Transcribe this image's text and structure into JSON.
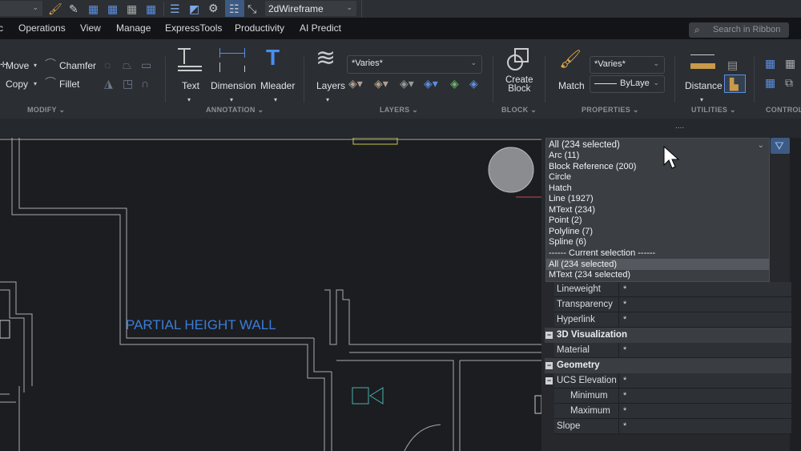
{
  "topbar": {
    "visual_style": "2dWireframe"
  },
  "menu": {
    "items": [
      "c",
      "Operations",
      "View",
      "Manage",
      "ExpressTools",
      "Productivity",
      "AI Predict"
    ],
    "search_placeholder": "Search in Ribbon"
  },
  "ribbon": {
    "modify": {
      "move": "Move",
      "copy": "Copy",
      "chamfer": "Chamfer",
      "fillet": "Fillet",
      "group": "MODIFY"
    },
    "annotation": {
      "text": "Text",
      "dimension": "Dimension",
      "mleader": "Mleader",
      "group": "ANNOTATION"
    },
    "layers": {
      "label": "Layers",
      "combo": "*Varies*",
      "group": "LAYERS"
    },
    "block": {
      "create_line1": "Create",
      "create_line2": "Block",
      "group": "BLOCK"
    },
    "properties": {
      "match": "Match",
      "color": "*Varies*",
      "linetype": "ByLaye",
      "group": "PROPERTIES"
    },
    "utilities": {
      "distance": "Distance",
      "group": "UTILITIES"
    },
    "control": {
      "group": "CONTROL"
    }
  },
  "strip": {
    "grip": "...."
  },
  "drawing": {
    "label": "PARTIAL HEIGHT WALL",
    "label_color": "#3b7dd8"
  },
  "selection": {
    "current": "All (234 selected)",
    "options": [
      "Arc (11)",
      "Block Reference (200)",
      "Circle",
      "Hatch",
      "Line (1927)",
      "MText (234)",
      "Point (2)",
      "Polyline (7)",
      "Spline (6)",
      "------ Current selection ------",
      "All (234 selected)",
      "MText (234 selected)"
    ]
  },
  "properties": {
    "rows": [
      {
        "label": "Lineweight",
        "value": "*"
      },
      {
        "label": "Transparency",
        "value": "*"
      },
      {
        "label": "Hyperlink",
        "value": "*"
      }
    ],
    "sec_3d": "3D Visualization",
    "material": {
      "label": "Material",
      "value": "*"
    },
    "sec_geom": "Geometry",
    "geom_rows": [
      {
        "label": "UCS Elevation",
        "value": "*"
      },
      {
        "label": "Minimum",
        "value": "*"
      },
      {
        "label": "Maximum",
        "value": "*"
      },
      {
        "label": "Slope",
        "value": "*"
      }
    ]
  }
}
